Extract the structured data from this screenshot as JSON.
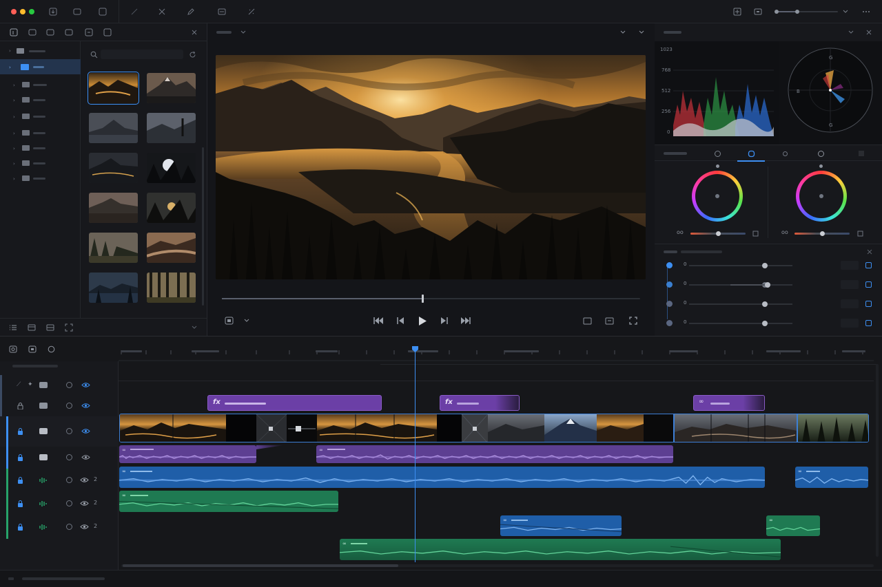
{
  "scopes": {
    "waveform_ticks": [
      "1023",
      "768",
      "512",
      "256",
      "0"
    ],
    "vectorscope_marks": [
      "B",
      "G"
    ]
  },
  "colors": {
    "accent": "#3d8ff2",
    "fx_clip": "#6b3fa6",
    "audio_purple": "#5d3f92",
    "audio_blue": "#1f5ea8",
    "audio_green": "#1f7a52"
  },
  "icons": {
    "fx": "fx",
    "link": "∞",
    "wheel_link": "oo"
  },
  "timeline": {
    "track_numbers": [
      "2",
      "2",
      "2"
    ]
  }
}
